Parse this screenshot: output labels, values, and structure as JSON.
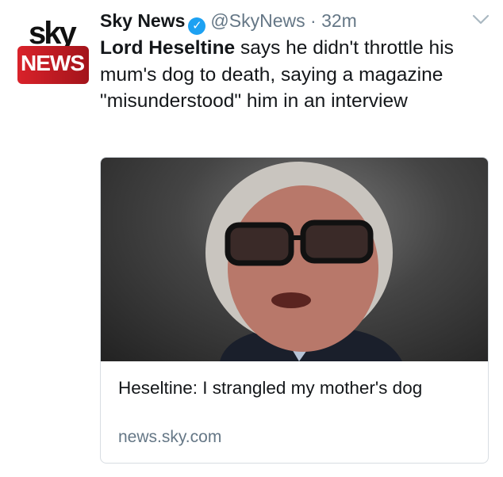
{
  "tweet": {
    "author_name": "Sky News",
    "handle": "@SkyNews",
    "separator": "·",
    "time": "32m",
    "verified": true,
    "text_bold": "Lord Heseltine",
    "text_rest": " says he didn't throttle his mum's dog to death, saying a magazine \"misunderstood\" him in an interview",
    "avatar_logo": {
      "top": "sky",
      "bottom": "NEWS"
    }
  },
  "card": {
    "title": "Heseltine: I strangled my mother's dog",
    "domain": "news.sky.com"
  },
  "colors": {
    "verified": "#1da1f2",
    "brand_red": "#d9222a",
    "muted": "#657786"
  }
}
